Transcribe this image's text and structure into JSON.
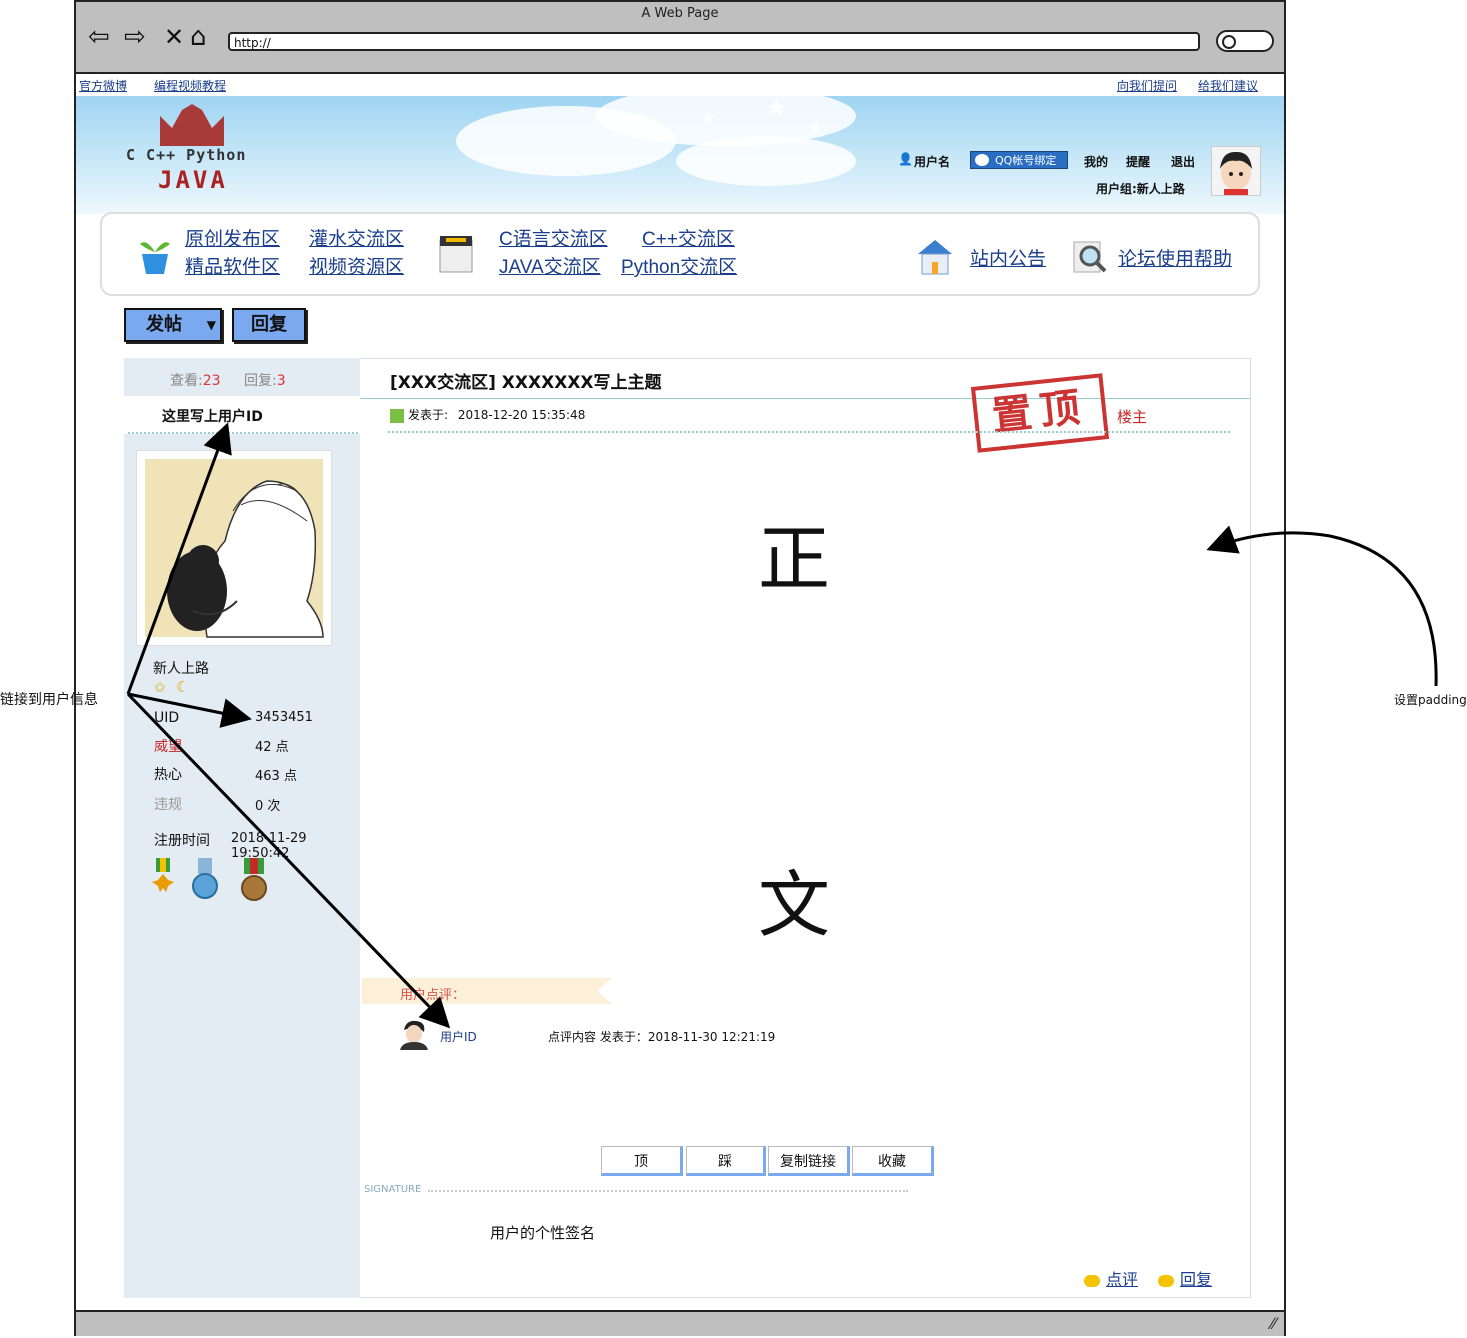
{
  "window": {
    "title": "A Web Page",
    "url": "http://"
  },
  "topbar": {
    "left_links": [
      "官方微博",
      "编程视频教程"
    ],
    "right_links": [
      "向我们提问",
      "给我们建议"
    ]
  },
  "header": {
    "logo_line1": "C C++ Python",
    "logo_line2": "JAVA",
    "username": "用户名",
    "qq_bind": "QQ帐号绑定",
    "my": "我的",
    "remind": "提醒",
    "logout": "退出",
    "user_group": "用户组:新人上路"
  },
  "nav": {
    "col1": [
      "原创发布区",
      "精品软件区"
    ],
    "col2": [
      "灌水交流区",
      "视频资源区"
    ],
    "col3": [
      "C语言交流区",
      "JAVA交流区"
    ],
    "col4": [
      "C++交流区",
      "Python交流区"
    ],
    "notice": "站内公告",
    "help": "论坛使用帮助"
  },
  "toolbar": {
    "post": "发帖",
    "reply": "回复"
  },
  "sidebar": {
    "views_label": "查看:",
    "views": "23",
    "replies_label": "回复:",
    "replies": "3",
    "user_id": "这里写上用户ID",
    "rank": "新人上路",
    "stats": [
      {
        "label": "UID",
        "value": "3453451",
        "color": "#111111"
      },
      {
        "label": "威望",
        "value": "42 点",
        "color": "#c62828"
      },
      {
        "label": "热心",
        "value": "463 点",
        "color": "#111111"
      },
      {
        "label": "违规",
        "value": "0 次",
        "color": "#999999"
      }
    ],
    "reg_label": "注册时间",
    "reg_time": "2018-11-29 19:50:42"
  },
  "post": {
    "title": "[XXX交流区] XXXXXXX写上主题",
    "posted_label": "发表于:",
    "posted_time": "2018-12-20 15:35:48",
    "sticky": "置顶",
    "floor": "楼主",
    "body_chars": [
      "正",
      "文"
    ],
    "comment_header": "用户点评：",
    "comment_user": "用户ID",
    "comment_text": "点评内容 发表于：2018-11-30 12:21:19",
    "actions": [
      "顶",
      "踩",
      "复制链接",
      "收藏"
    ],
    "signature_label": "SIGNATURE",
    "signature": "用户的个性签名",
    "footer_links": [
      "点评",
      "回复"
    ]
  },
  "annotations": {
    "left_note": "链接到用户信息",
    "right_note": "设置padding"
  },
  "colors": {
    "accent_blue": "#7aa9f0",
    "link": "#1a3e8c",
    "stamp_red": "#cc3333"
  }
}
